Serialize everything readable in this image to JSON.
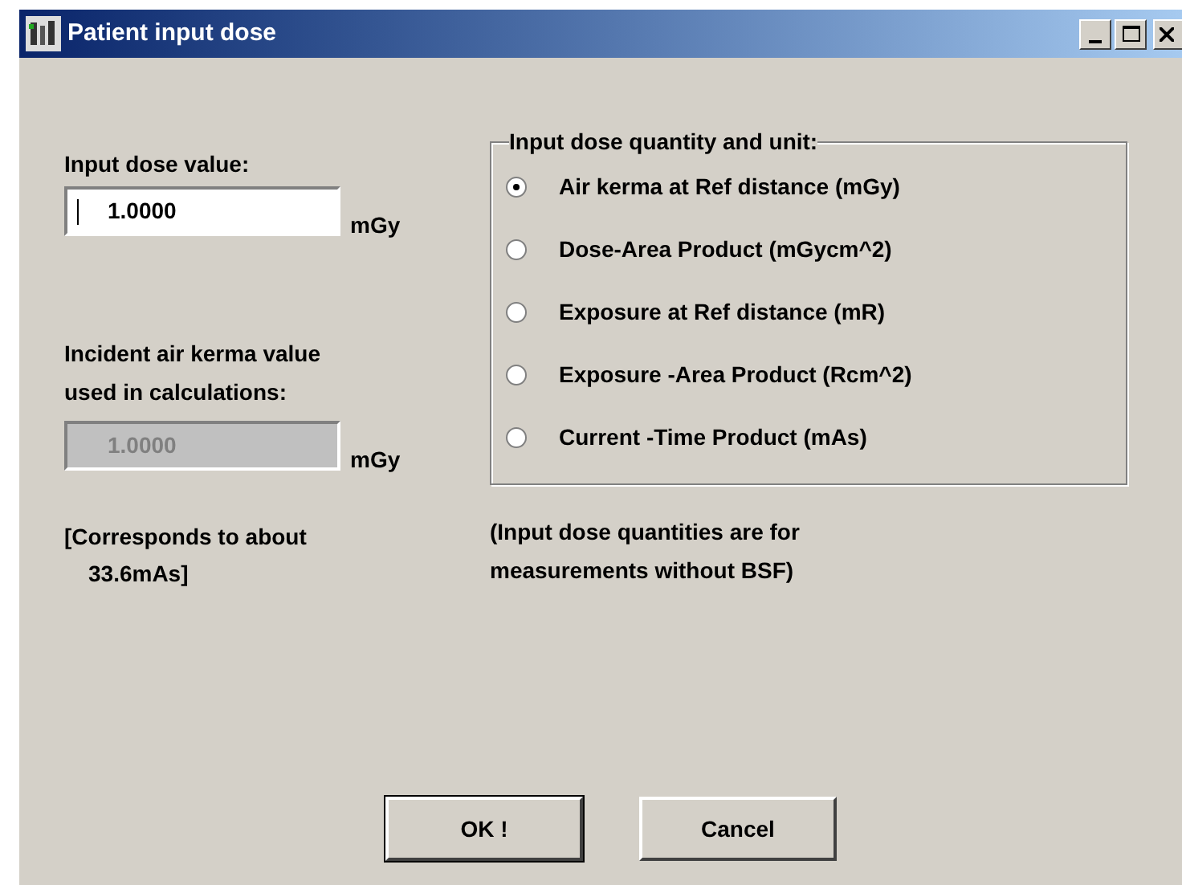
{
  "window": {
    "title": "Patient input dose"
  },
  "input_dose": {
    "label": "Input dose value:",
    "value": "1.0000",
    "unit": "mGy",
    "disabled": false
  },
  "incident_kerma": {
    "label_lines": [
      "Incident air kerma value",
      "used in calculations:"
    ],
    "value": "1.0000",
    "unit": "mGy",
    "disabled": true
  },
  "corresponds": [
    "[Corresponds to about",
    "33.6mAs]"
  ],
  "quantity_group": {
    "legend": "Input dose quantity and unit:",
    "options": [
      {
        "label": "Air kerma at Ref distance (mGy)",
        "selected": true
      },
      {
        "label": "Dose-Area Product (mGycm^2)",
        "selected": false
      },
      {
        "label": "Exposure at Ref distance (mR)",
        "selected": false
      },
      {
        "label": "Exposure -Area Product (Rcm^2)",
        "selected": false
      },
      {
        "label": "Current -Time Product (mAs)",
        "selected": false
      }
    ]
  },
  "note": [
    "(Input dose quantities are for",
    "measurements without BSF)"
  ],
  "buttons": [
    {
      "label": "OK !",
      "default": true
    },
    {
      "label": "Cancel",
      "default": false
    }
  ]
}
